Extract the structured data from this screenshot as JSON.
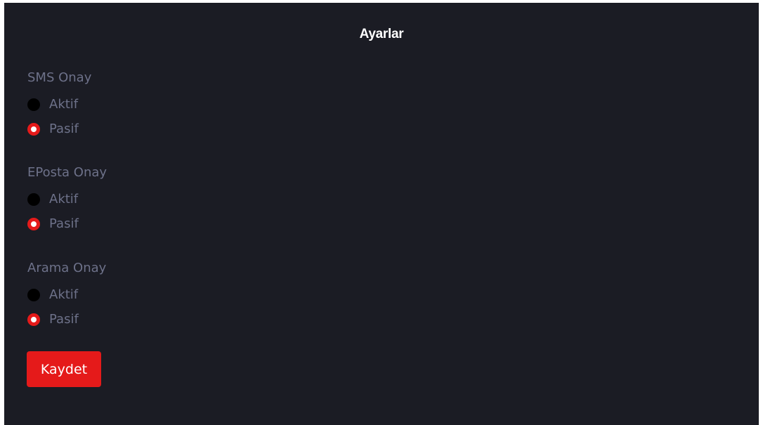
{
  "title": "Ayarlar",
  "groups": [
    {
      "label": "SMS Onay",
      "options": [
        {
          "label": "Aktif",
          "checked": false
        },
        {
          "label": "Pasif",
          "checked": true
        }
      ]
    },
    {
      "label": "EPosta Onay",
      "options": [
        {
          "label": "Aktif",
          "checked": false
        },
        {
          "label": "Pasif",
          "checked": true
        }
      ]
    },
    {
      "label": "Arama Onay",
      "options": [
        {
          "label": "Aktif",
          "checked": false
        },
        {
          "label": "Pasif",
          "checked": true
        }
      ]
    }
  ],
  "save_label": "Kaydet",
  "colors": {
    "background": "#1b1c24",
    "accent": "#e51a1a",
    "muted_text": "#6d7189",
    "unchecked_radio": "#000000"
  }
}
